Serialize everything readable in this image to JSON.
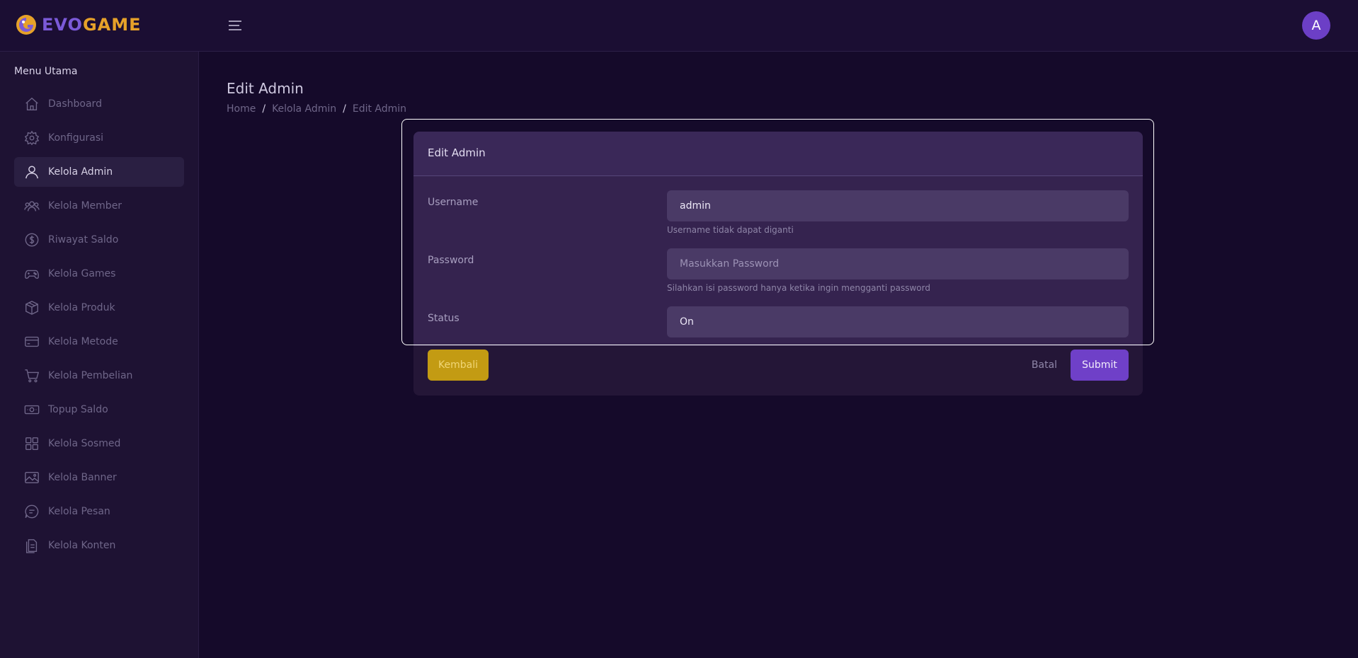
{
  "brand": {
    "part1": "EVO",
    "part2": "GAME"
  },
  "user": {
    "avatar_letter": "A"
  },
  "sidebar": {
    "section_title": "Menu Utama",
    "items": [
      {
        "label": "Dashboard",
        "icon": "home-icon"
      },
      {
        "label": "Konfigurasi",
        "icon": "gear-icon"
      },
      {
        "label": "Kelola Admin",
        "icon": "user-icon",
        "active": true
      },
      {
        "label": "Kelola Member",
        "icon": "users-icon"
      },
      {
        "label": "Riwayat Saldo",
        "icon": "dollar-circle-icon"
      },
      {
        "label": "Kelola Games",
        "icon": "gamepad-icon"
      },
      {
        "label": "Kelola Produk",
        "icon": "box-icon"
      },
      {
        "label": "Kelola Metode",
        "icon": "credit-card-icon"
      },
      {
        "label": "Kelola Pembelian",
        "icon": "cart-icon"
      },
      {
        "label": "Topup Saldo",
        "icon": "cash-icon"
      },
      {
        "label": "Kelola Sosmed",
        "icon": "grid-icon"
      },
      {
        "label": "Kelola Banner",
        "icon": "image-icon"
      },
      {
        "label": "Kelola Pesan",
        "icon": "chat-icon"
      },
      {
        "label": "Kelola Konten",
        "icon": "document-icon"
      }
    ]
  },
  "page": {
    "title": "Edit Admin",
    "breadcrumb": [
      "Home",
      "Kelola Admin",
      "Edit Admin"
    ],
    "breadcrumb_sep": "/"
  },
  "form": {
    "card_title": "Edit Admin",
    "username": {
      "label": "Username",
      "value": "admin",
      "hint": "Username tidak dapat diganti"
    },
    "password": {
      "label": "Password",
      "placeholder": "Masukkan Password",
      "hint": "Silahkan isi password hanya ketika ingin mengganti password"
    },
    "status": {
      "label": "Status",
      "value": "On"
    },
    "buttons": {
      "back": "Kembali",
      "cancel": "Batal",
      "submit": "Submit"
    }
  },
  "colors": {
    "accent": "#6f40c8",
    "back_button": "#c39b13",
    "background": "#150a2a",
    "sidebar": "#1e1233"
  }
}
